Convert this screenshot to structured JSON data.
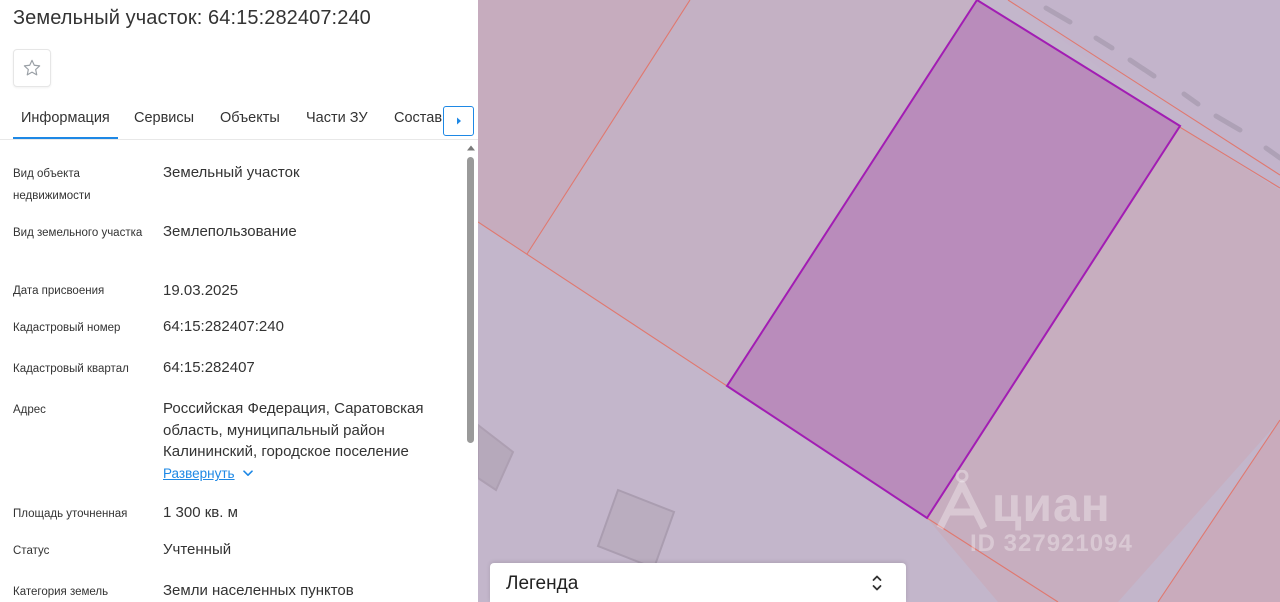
{
  "header": {
    "title": "Земельный участок: 64:15:282407:240"
  },
  "tabs": [
    {
      "label": "Информация",
      "active": true
    },
    {
      "label": "Сервисы"
    },
    {
      "label": "Объекты"
    },
    {
      "label": "Части ЗУ"
    },
    {
      "label": "Состав"
    }
  ],
  "properties": [
    {
      "label": "Вид объекта недвижимости",
      "value": "Земельный участок"
    },
    {
      "label": "Вид земельного участка",
      "value": "Землепользование"
    },
    {
      "label": "Дата присвоения",
      "value": "19.03.2025"
    },
    {
      "label": "Кадастровый номер",
      "value": "64:15:282407:240"
    },
    {
      "label": "Кадастровый квартал",
      "value": "64:15:282407"
    },
    {
      "label": "Адрес",
      "value": "Российская Федерация, Саратовская область, муниципальный район Калининский, городское поселение"
    },
    {
      "label": "Площадь уточненная",
      "value": "1 300 кв. м"
    },
    {
      "label": "Статус",
      "value": "Учтенный"
    },
    {
      "label": "Категория земель",
      "value": "Земли населенных пунктов"
    }
  ],
  "address_expand_label": "Развернуть",
  "legend": {
    "label": "Легенда"
  },
  "watermark": {
    "brand": "циан",
    "id": "ID 327921094"
  },
  "colors": {
    "accent": "#1e88e5",
    "map_background": "#c3b6cb",
    "selected_parcel_fill": "#b98cbb",
    "selected_parcel_stroke": "#a21db3",
    "parcel_border": "#e0786f"
  },
  "icons": {
    "favorite": "star-outline-icon",
    "tabs_next": "caret-right-icon",
    "expand": "chevron-down-icon",
    "legend_toggle": "chevrons-up-down-icon"
  }
}
